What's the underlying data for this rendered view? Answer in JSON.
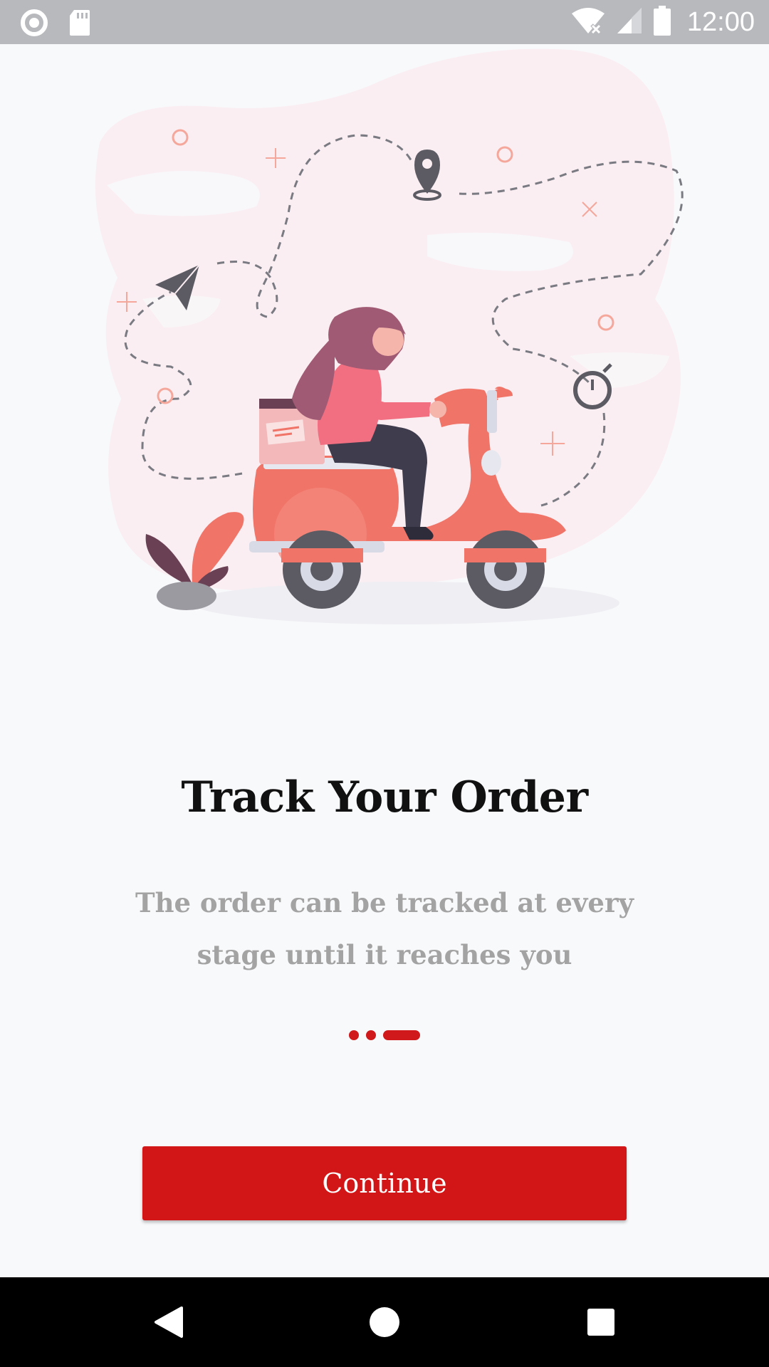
{
  "status_bar": {
    "time": "12:00",
    "icons": [
      "circle-notification-icon",
      "sd-card-icon",
      "wifi-off-icon",
      "signal-icon",
      "battery-icon"
    ]
  },
  "illustration": {
    "subject": "delivery-scooter-illustration"
  },
  "onboarding": {
    "title": "Track Your Order",
    "subtitle": "The order can be tracked at every stage until it reaches you",
    "pager": {
      "total": 3,
      "active_index": 2
    },
    "continue_label": "Continue"
  },
  "nav_bar": {
    "icons": [
      "back-icon",
      "home-icon",
      "recents-icon"
    ]
  },
  "colors": {
    "accent": "#d21618",
    "background": "#f8f9fb",
    "status_bar": "#b8b9bd",
    "subtitle": "#a3a3a3"
  }
}
